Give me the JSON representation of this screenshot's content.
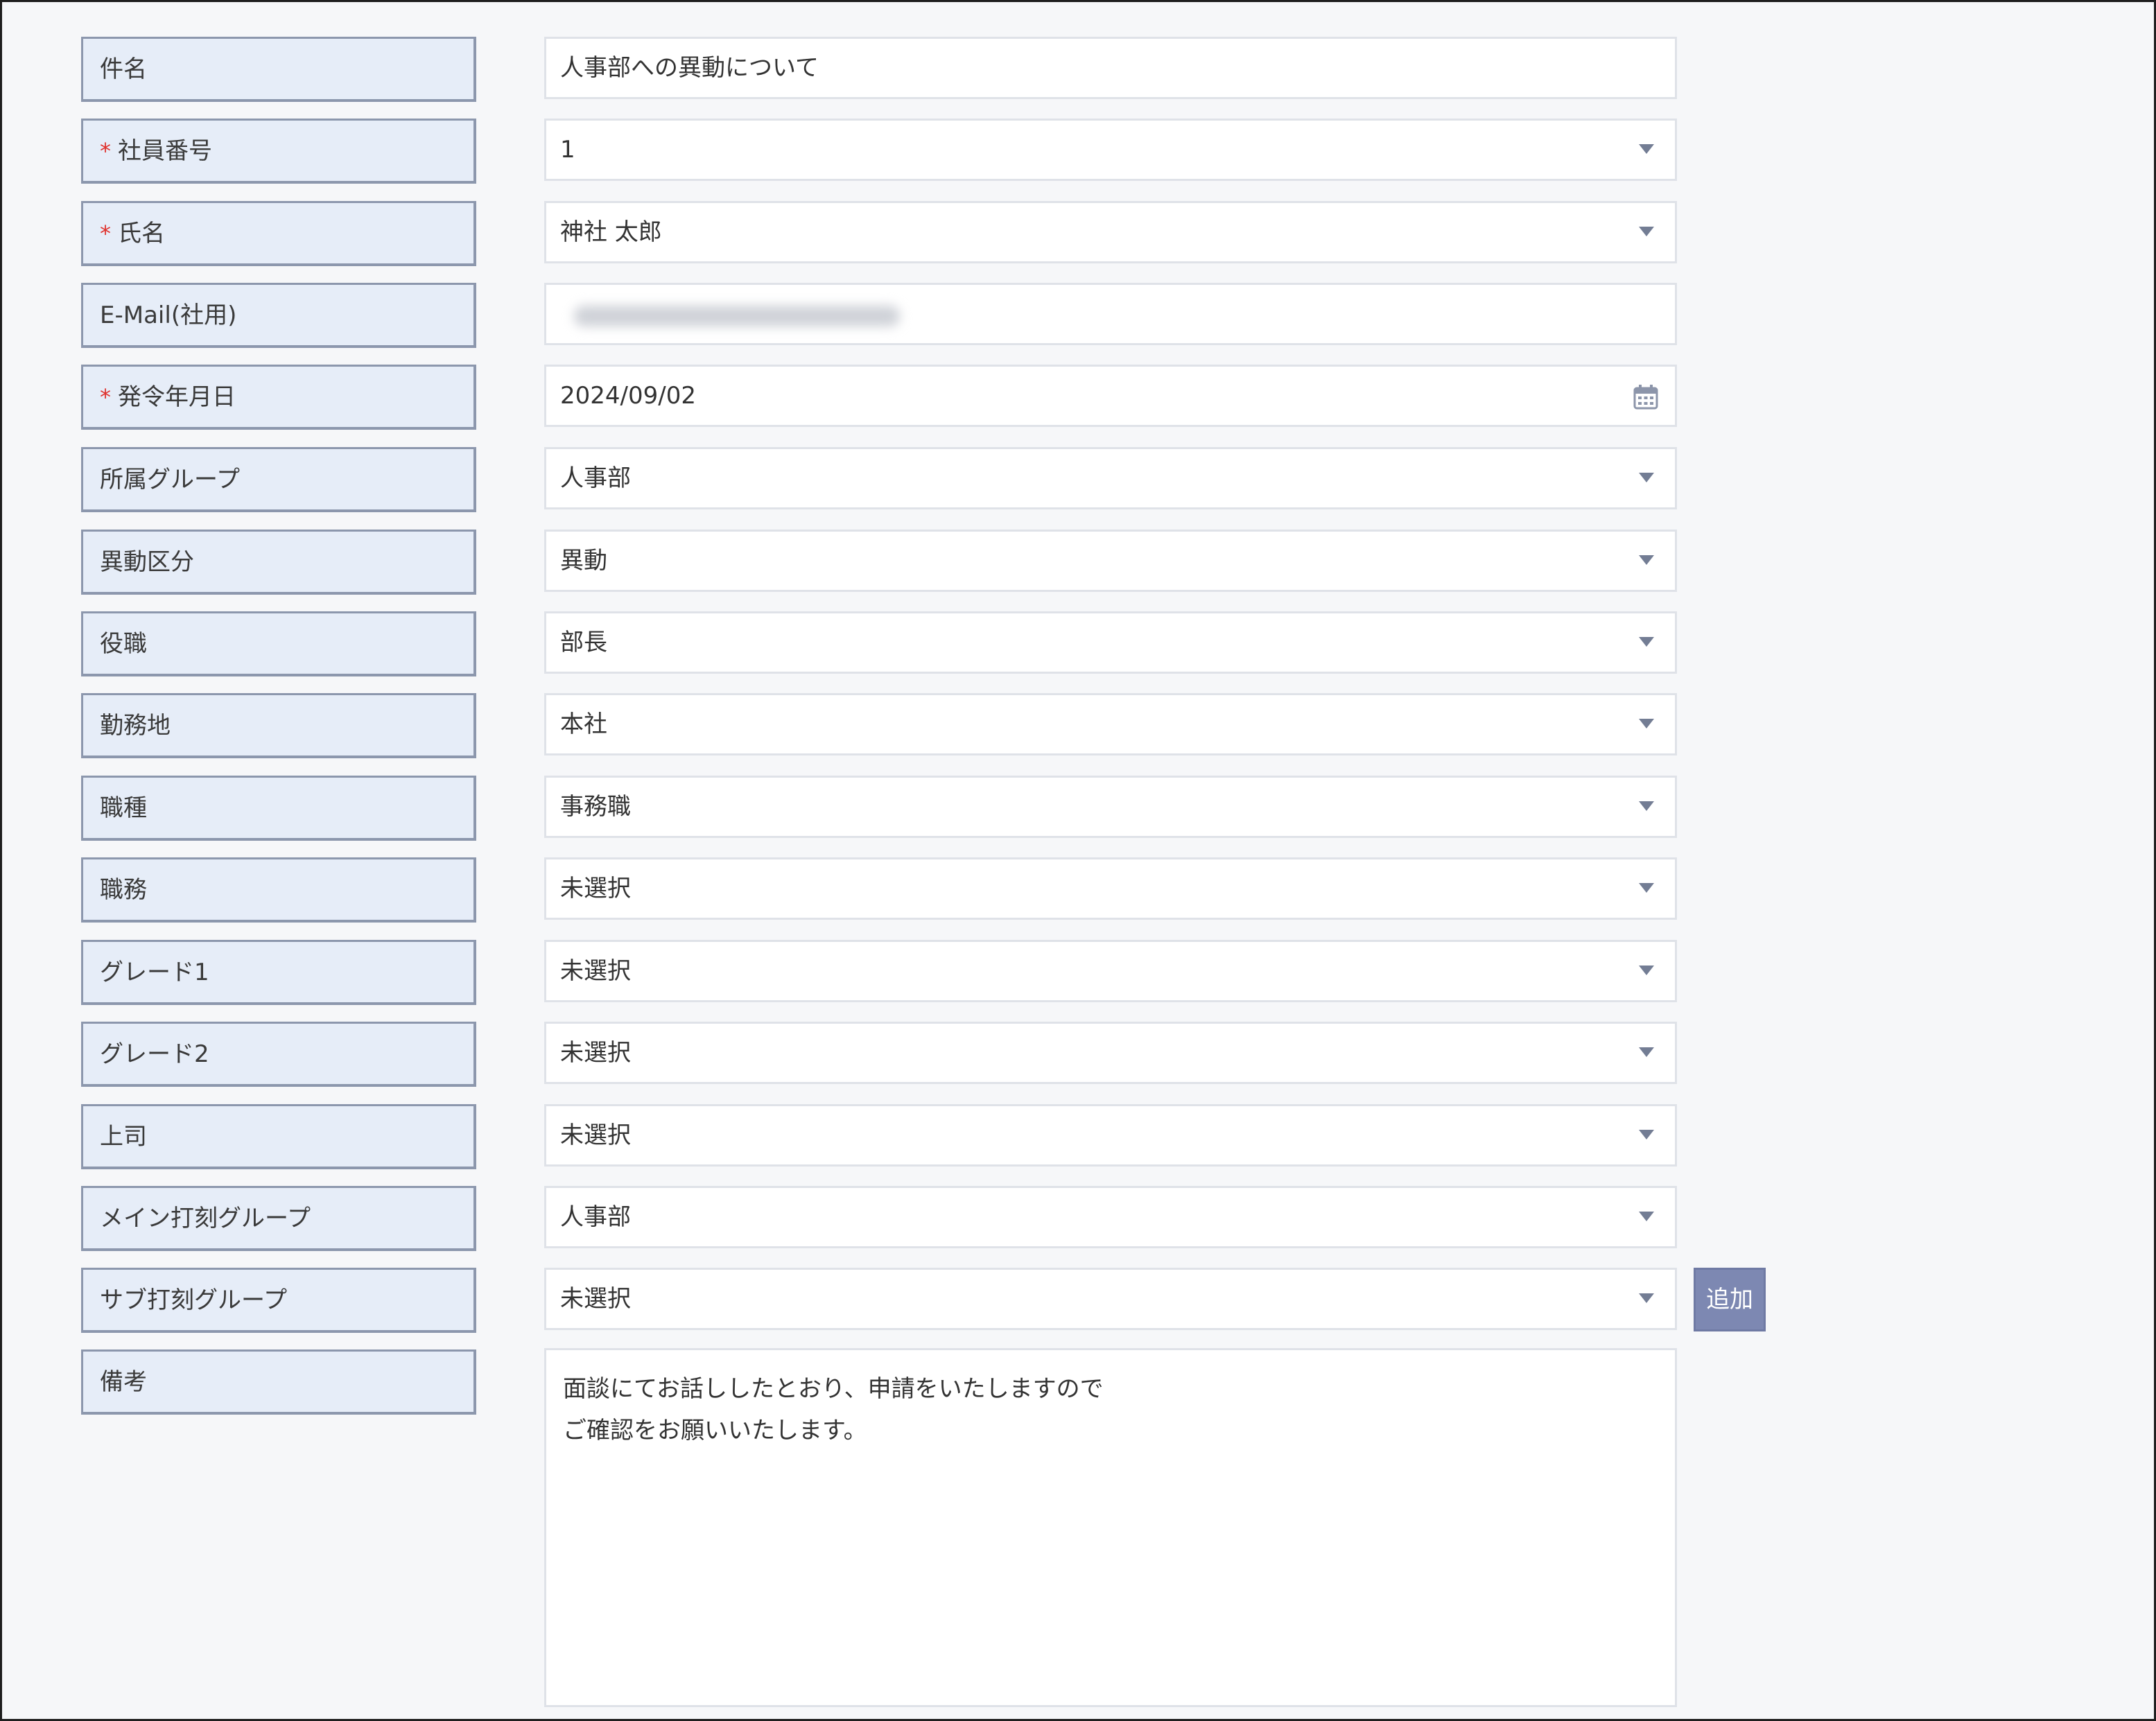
{
  "form": {
    "rows": [
      {
        "label": "件名",
        "required": false,
        "value": "人事部への異動について",
        "type": "text"
      },
      {
        "label": "社員番号",
        "required": true,
        "value": "1",
        "type": "select"
      },
      {
        "label": "氏名",
        "required": true,
        "value": "神社 太郎",
        "type": "select"
      },
      {
        "label": "E-Mail(社用)",
        "required": false,
        "value": "",
        "type": "email-blurred"
      },
      {
        "label": "発令年月日",
        "required": true,
        "value": "2024/09/02",
        "type": "date"
      },
      {
        "label": "所属グループ",
        "required": false,
        "value": "人事部",
        "type": "select"
      },
      {
        "label": "異動区分",
        "required": false,
        "value": "異動",
        "type": "select"
      },
      {
        "label": "役職",
        "required": false,
        "value": "部長",
        "type": "select"
      },
      {
        "label": "勤務地",
        "required": false,
        "value": "本社",
        "type": "select"
      },
      {
        "label": "職種",
        "required": false,
        "value": "事務職",
        "type": "select"
      },
      {
        "label": "職務",
        "required": false,
        "value": "未選択",
        "type": "select"
      },
      {
        "label": "グレード1",
        "required": false,
        "value": "未選択",
        "type": "select"
      },
      {
        "label": "グレード2",
        "required": false,
        "value": "未選択",
        "type": "select"
      },
      {
        "label": "上司",
        "required": false,
        "value": "未選択",
        "type": "select"
      },
      {
        "label": "メイン打刻グループ",
        "required": false,
        "value": "人事部",
        "type": "select"
      },
      {
        "label": "サブ打刻グループ",
        "required": false,
        "value": "未選択",
        "type": "select"
      },
      {
        "label": "備考",
        "required": false,
        "type": "textarea"
      }
    ],
    "required_mark": "*",
    "add_button_label": "追加",
    "remarks_lines": [
      "面談にてお話ししたとおり、申請をいたしますので",
      "ご確認をお願いいたします。"
    ]
  },
  "colors": {
    "label_bg": "#e6edf8",
    "label_border": "#8c97ad",
    "required": "#e0322d",
    "button_bg": "#7d88b2",
    "dropdown_arrow": "#737d94"
  },
  "icons": {
    "dropdown": "chevron-down-icon",
    "date": "calendar-icon"
  }
}
